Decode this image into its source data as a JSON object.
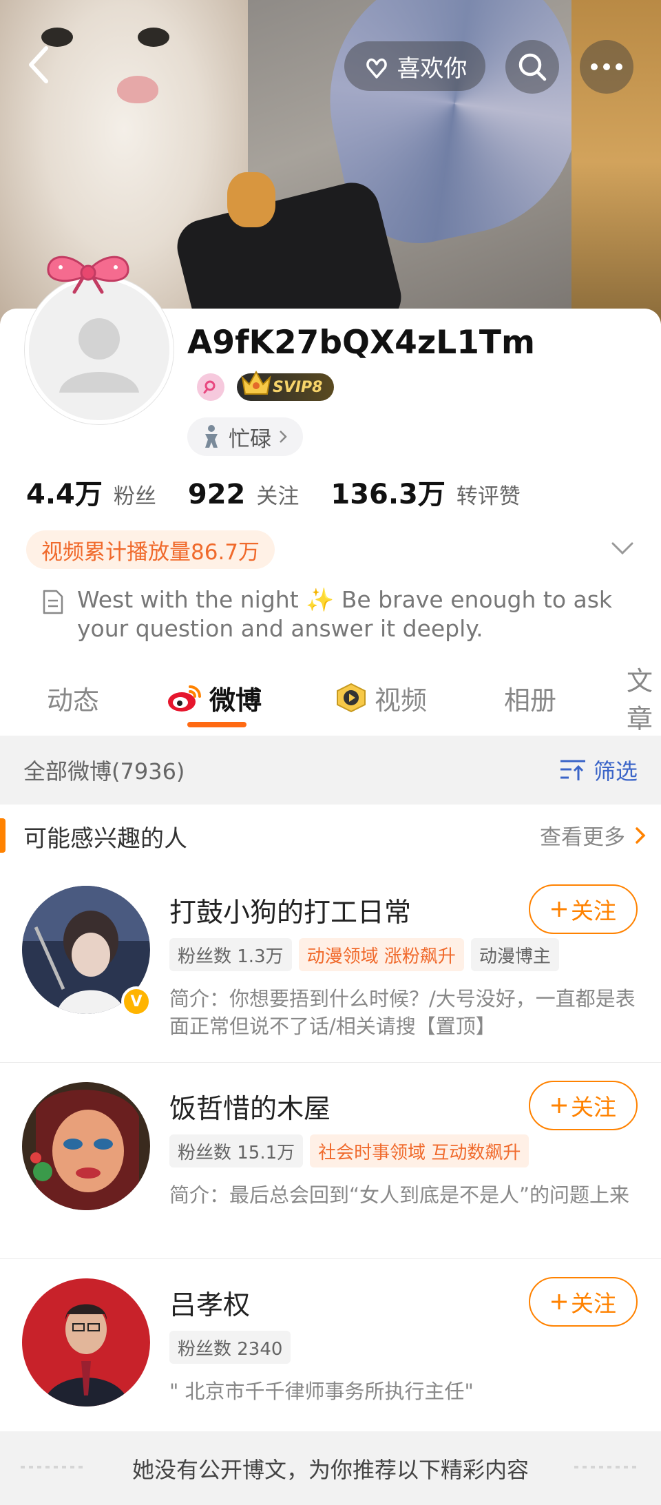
{
  "header": {
    "like_label": "喜欢你"
  },
  "profile": {
    "username": "A9fK27bQX4zL1Tm",
    "svip_label": "SVIP8",
    "status_label": "忙碌",
    "stats": [
      {
        "value": "4.4万",
        "label": "粉丝"
      },
      {
        "value": "922",
        "label": "关注"
      },
      {
        "value": "136.3万",
        "label": "转评赞"
      }
    ],
    "views_label": "视频累计播放量86.7万",
    "bio": "West with the night ✨ Be brave enough to ask your question and answer it deeply."
  },
  "tabs": [
    {
      "label": "动态"
    },
    {
      "label": "微博"
    },
    {
      "label": "视频"
    },
    {
      "label": "相册"
    },
    {
      "label": "文章"
    }
  ],
  "feed": {
    "count_label": "全部微博(7936)",
    "filter_label": "筛选"
  },
  "suggestions": {
    "title": "可能感兴趣的人",
    "see_more": "查看更多",
    "follow_label": "关注",
    "users": [
      {
        "name": "打鼓小狗的打工日常",
        "tags": [
          "粉丝数 1.3万",
          "动漫领域 涨粉飙升",
          "动漫博主"
        ],
        "intro": "简介：你想要捂到什么时候？/大号没好，一直都是表面正常但说不了话/相关请搜【置顶】"
      },
      {
        "name": "饭哲惜的木屋",
        "tags": [
          "粉丝数 15.1万",
          "社会时事领域 互动数飙升"
        ],
        "intro": "简介：最后总会回到“女人到底是不是人”的问题上来"
      },
      {
        "name": "吕孝权",
        "tags": [
          "粉丝数 2340"
        ],
        "intro": "\" 北京市千千律师事务所执行主任\""
      }
    ]
  },
  "notice": "她没有公开博文，为你推荐以下精彩内容",
  "colors": {
    "accent": "#ff8200",
    "tab_underline": "#ff6a13",
    "link_blue": "#3a64c8"
  }
}
